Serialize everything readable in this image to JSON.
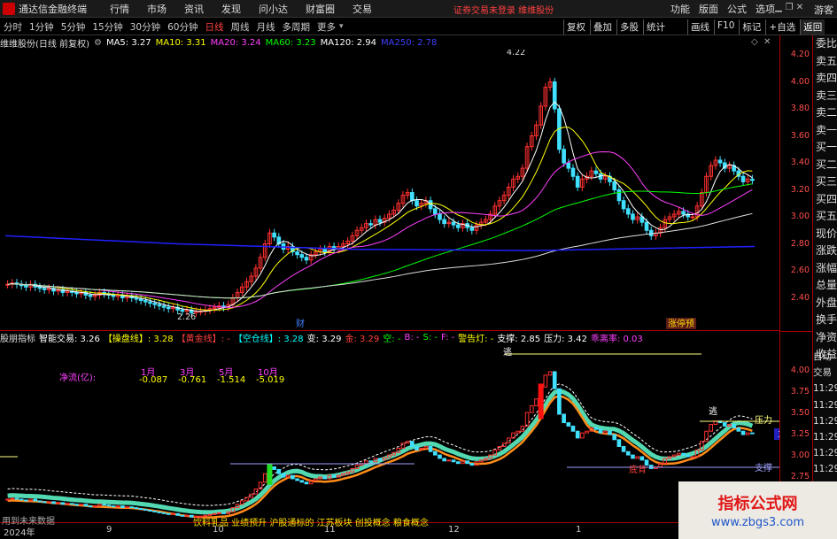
{
  "titlebar": {
    "app_title": "通达信金融终端",
    "menus": [
      "行情",
      "市场",
      "资讯",
      "发现",
      "问小达",
      "财富圈",
      "交易"
    ],
    "notice": "证券交易未登录 维维股份",
    "right_menus": [
      "功能",
      "版面",
      "公式",
      "选项"
    ],
    "guest": "游客"
  },
  "toolbar": {
    "periods": [
      "分时",
      "1分钟",
      "5分钟",
      "15分钟",
      "30分钟",
      "60分钟",
      "日线",
      "周线",
      "月线",
      "多周期",
      "更多"
    ],
    "active_period": "日线",
    "buttons1": [
      "复权",
      "叠加",
      "多股",
      "统计"
    ],
    "buttons2": [
      "画线",
      "F10",
      "标记",
      "+自选",
      "返回"
    ]
  },
  "info": {
    "stock": "维维股份(日线 前复权)",
    "mas": [
      {
        "label": "MA5: 3.27",
        "color": "#ffffff"
      },
      {
        "label": "MA10: 3.31",
        "color": "#ffff00"
      },
      {
        "label": "MA20: 3.24",
        "color": "#ff40ff"
      },
      {
        "label": "MA60: 3.23",
        "color": "#00ff00"
      },
      {
        "label": "MA120: 2.94",
        "color": "#ffffff"
      },
      {
        "label": "MA250: 2.78",
        "color": "#4040ff"
      }
    ]
  },
  "main_axis": [
    "4.20",
    "4.00",
    "3.80",
    "3.60",
    "3.40",
    "3.20",
    "3.00",
    "2.80",
    "2.60",
    "2.40"
  ],
  "main_labels": {
    "high": "4.22",
    "low": "2.26",
    "cai": "财",
    "tag": "涨停预"
  },
  "sub_info": [
    {
      "t": "股朋指标",
      "c": "#dddddd"
    },
    {
      "t": "智能交易: 3.26",
      "c": "#ffffff"
    },
    {
      "t": "【操盘线】: 3.28",
      "c": "#ffff00"
    },
    {
      "t": "【黄金线】: -",
      "c": "#ff4040"
    },
    {
      "t": "【空仓线】: 3.28",
      "c": "#00ffff"
    },
    {
      "t": "变: 3.29",
      "c": "#ffffff"
    },
    {
      "t": "金: 3.29",
      "c": "#ff4040"
    },
    {
      "t": "空: -",
      "c": "#00ff00"
    },
    {
      "t": "B: -",
      "c": "#ff40ff"
    },
    {
      "t": "S: -",
      "c": "#00ff00"
    },
    {
      "t": "F: -",
      "c": "#ff40ff"
    },
    {
      "t": "警告灯: -",
      "c": "#ffff00"
    },
    {
      "t": "支撑: 2.85",
      "c": "#ffffff"
    },
    {
      "t": "压力: 3.42",
      "c": "#ffffff"
    },
    {
      "t": "乖离率: 0.03",
      "c": "#ff40ff"
    }
  ],
  "netflow": {
    "label": "净流(亿):",
    "cols": [
      {
        "m": "1月",
        "v": "-0.087"
      },
      {
        "m": "3月",
        "v": "-0.761"
      },
      {
        "m": "5月",
        "v": "-1.514"
      },
      {
        "m": "10月",
        "v": "-5.019"
      }
    ]
  },
  "sub_axis": [
    "4.00",
    "3.75",
    "3.50",
    "3.25",
    "3.00",
    "2.75"
  ],
  "sub_labels": {
    "pressure": "压力",
    "support": "支撑",
    "escape": "逃",
    "top": "逃",
    "current": "3.16",
    "bottom": "底背"
  },
  "sidebar": [
    "委比",
    "卖五",
    "卖四",
    "卖三",
    "卖二",
    "卖一",
    "买一",
    "买二",
    "买三",
    "买四",
    "买五",
    "现价",
    "涨跌",
    "涨幅",
    "总量",
    "外盘",
    "换手",
    "净资",
    "收益"
  ],
  "sidebar2": [
    "自动",
    "交易",
    "11:29",
    "11:29",
    "11:29",
    "11:29",
    "11:29",
    "11:29",
    "11:29",
    "11:29",
    "11:29"
  ],
  "xaxis": [
    {
      "label": "2024年",
      "pos": 4
    },
    {
      "label": "9",
      "pos": 120
    },
    {
      "label": "10",
      "pos": 240
    },
    {
      "label": "11",
      "pos": 366
    },
    {
      "label": "12",
      "pos": 506
    },
    {
      "label": "1",
      "pos": 650
    }
  ],
  "hint": "用到未来数据",
  "tags": "饮料乳品 业绩预升 沪股通标的 江苏板块 创投概念 粮食概念",
  "watermark": {
    "line1": "指标公式网",
    "line2": "www.zbgs3.com"
  }
}
